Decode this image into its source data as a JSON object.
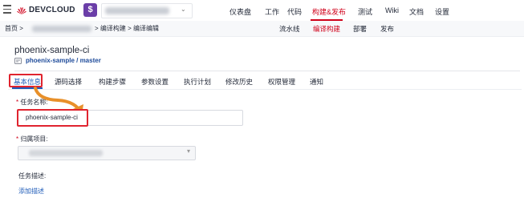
{
  "brand": {
    "name": "DEVCLOUD",
    "accent": "#d0021b"
  },
  "project": {
    "icon_letter": "$"
  },
  "topnav": {
    "items": [
      {
        "label": "仪表盘"
      },
      {
        "label": "工作"
      },
      {
        "label": "代码"
      },
      {
        "label": "构建&发布",
        "active": true
      },
      {
        "label": "测试"
      },
      {
        "label": "Wiki"
      },
      {
        "label": "文档"
      },
      {
        "label": "设置"
      }
    ]
  },
  "breadcrumb": {
    "home": "首页 >",
    "tail": "> 编译构建 > 编译编辑"
  },
  "subnav": {
    "items": [
      {
        "label": "流水线"
      },
      {
        "label": "编译构建",
        "active": true
      },
      {
        "label": "部署"
      },
      {
        "label": "发布"
      }
    ]
  },
  "job": {
    "title": "phoenix-sample-ci",
    "repo": "phoenix-sample / master"
  },
  "tabs": {
    "items": [
      {
        "label": "基本信息",
        "active": true
      },
      {
        "label": "源码选择"
      },
      {
        "label": "构建步骤"
      },
      {
        "label": "参数设置"
      },
      {
        "label": "执行计划"
      },
      {
        "label": "修改历史"
      },
      {
        "label": "权限管理"
      },
      {
        "label": "通知"
      }
    ]
  },
  "form": {
    "task_name": {
      "required_mark": "*",
      "label": "任务名称:",
      "value": "phoenix-sample-ci"
    },
    "project": {
      "required_mark": "*",
      "label": "归属项目:"
    },
    "description": {
      "label": "任务描述:",
      "add_link": "添加描述"
    }
  },
  "colors": {
    "highlight": "#e0242f",
    "link": "#1e5bb8",
    "arrow": "#e8902a"
  }
}
